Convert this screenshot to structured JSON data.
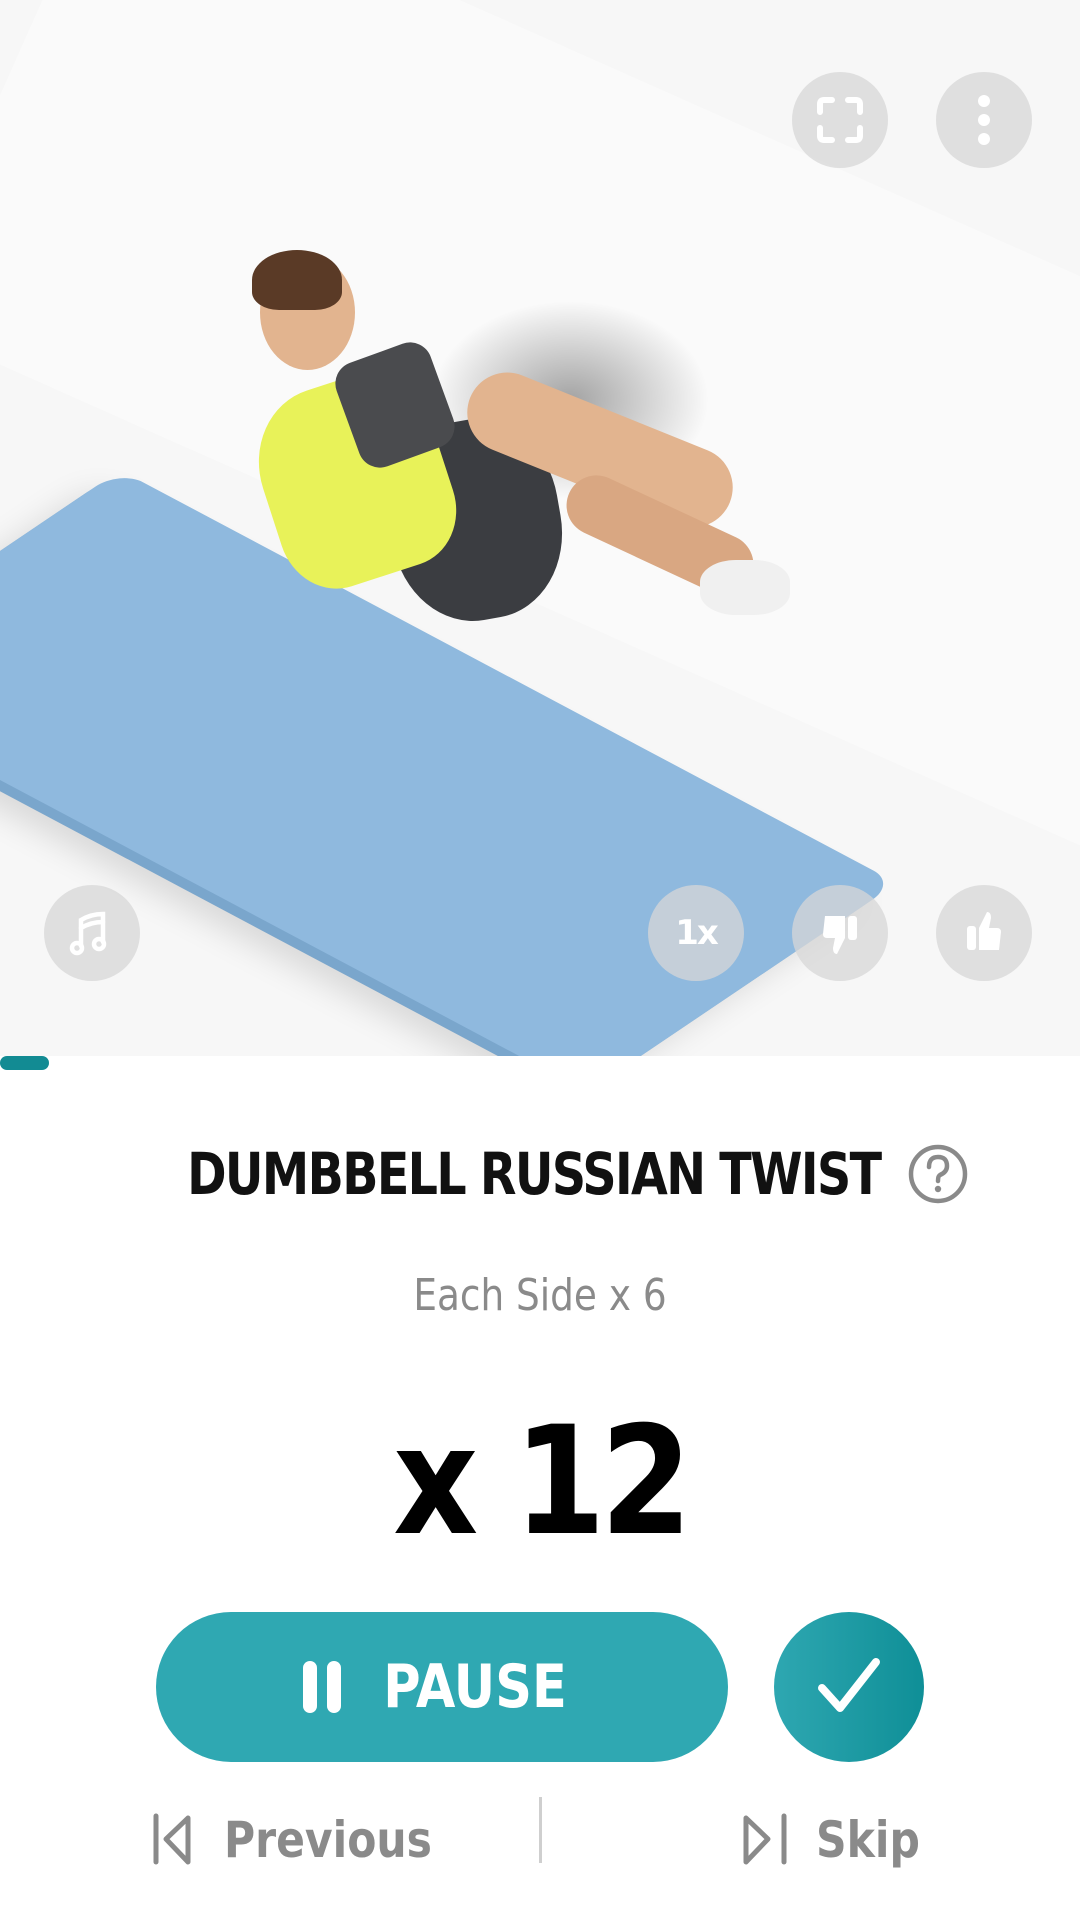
{
  "exercise": {
    "title": "DUMBBELL RUSSIAN TWIST",
    "subtitle": "Each Side x 6",
    "reps": "x 12"
  },
  "video_controls": {
    "top": [
      {
        "name": "fullscreen",
        "icon": "fullscreen-icon"
      },
      {
        "name": "more-options",
        "icon": "more-vertical-icon"
      }
    ],
    "bottom": [
      {
        "name": "music",
        "icon": "music-note-icon"
      },
      {
        "name": "speed",
        "label": "1x"
      },
      {
        "name": "dislike",
        "icon": "thumbs-down-icon"
      },
      {
        "name": "like",
        "icon": "thumbs-up-icon"
      }
    ]
  },
  "progress": {
    "fraction": 0.045,
    "color": "#128b93"
  },
  "actions": {
    "pause_label": "PAUSE",
    "done_icon": "check-icon",
    "previous_label": "Previous",
    "skip_label": "Skip"
  },
  "colors": {
    "accent": "#2fa8b2",
    "accent_dark": "#0f8f97",
    "title": "#111111",
    "muted": "#8a8a8a"
  }
}
